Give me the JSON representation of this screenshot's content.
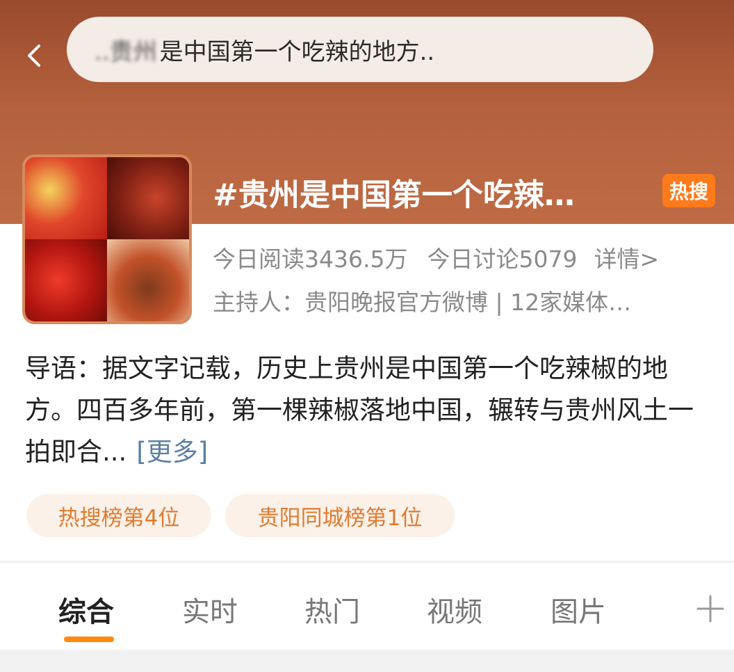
{
  "search": {
    "blurred_prefix": "..贵州",
    "query": "是中国第一个吃辣的地方.."
  },
  "topic": {
    "title": "#贵州是中国第一个吃辣…",
    "badge": "热搜",
    "read_count": "今日阅读3436.5万",
    "discuss_count": "今日讨论5079",
    "detail_link": "详情>",
    "host": "主持人：贵阳晚报官方微博 | 12家媒体…"
  },
  "intro": {
    "text": "导语：据文字记载，历史上贵州是中国第一个吃辣椒的地方。四百多年前，第一棵辣椒落地中国，辗转与贵州风土一拍即合...",
    "more_label": "[更多]"
  },
  "tags": [
    {
      "label": "热搜榜第4位"
    },
    {
      "label": "贵阳同城榜第1位"
    }
  ],
  "tabs": [
    {
      "label": "综合",
      "active": true
    },
    {
      "label": "实时",
      "active": false
    },
    {
      "label": "热门",
      "active": false
    },
    {
      "label": "视频",
      "active": false
    },
    {
      "label": "图片",
      "active": false
    }
  ],
  "icons": {
    "back": "chevron-left-icon",
    "add": "plus-icon"
  },
  "colors": {
    "header": "#b3603c",
    "hot_badge": "#ff7a1a",
    "tab_indicator": "#ff8a10",
    "tag_text": "#e07a2e",
    "more_link": "#5c7fa5"
  }
}
